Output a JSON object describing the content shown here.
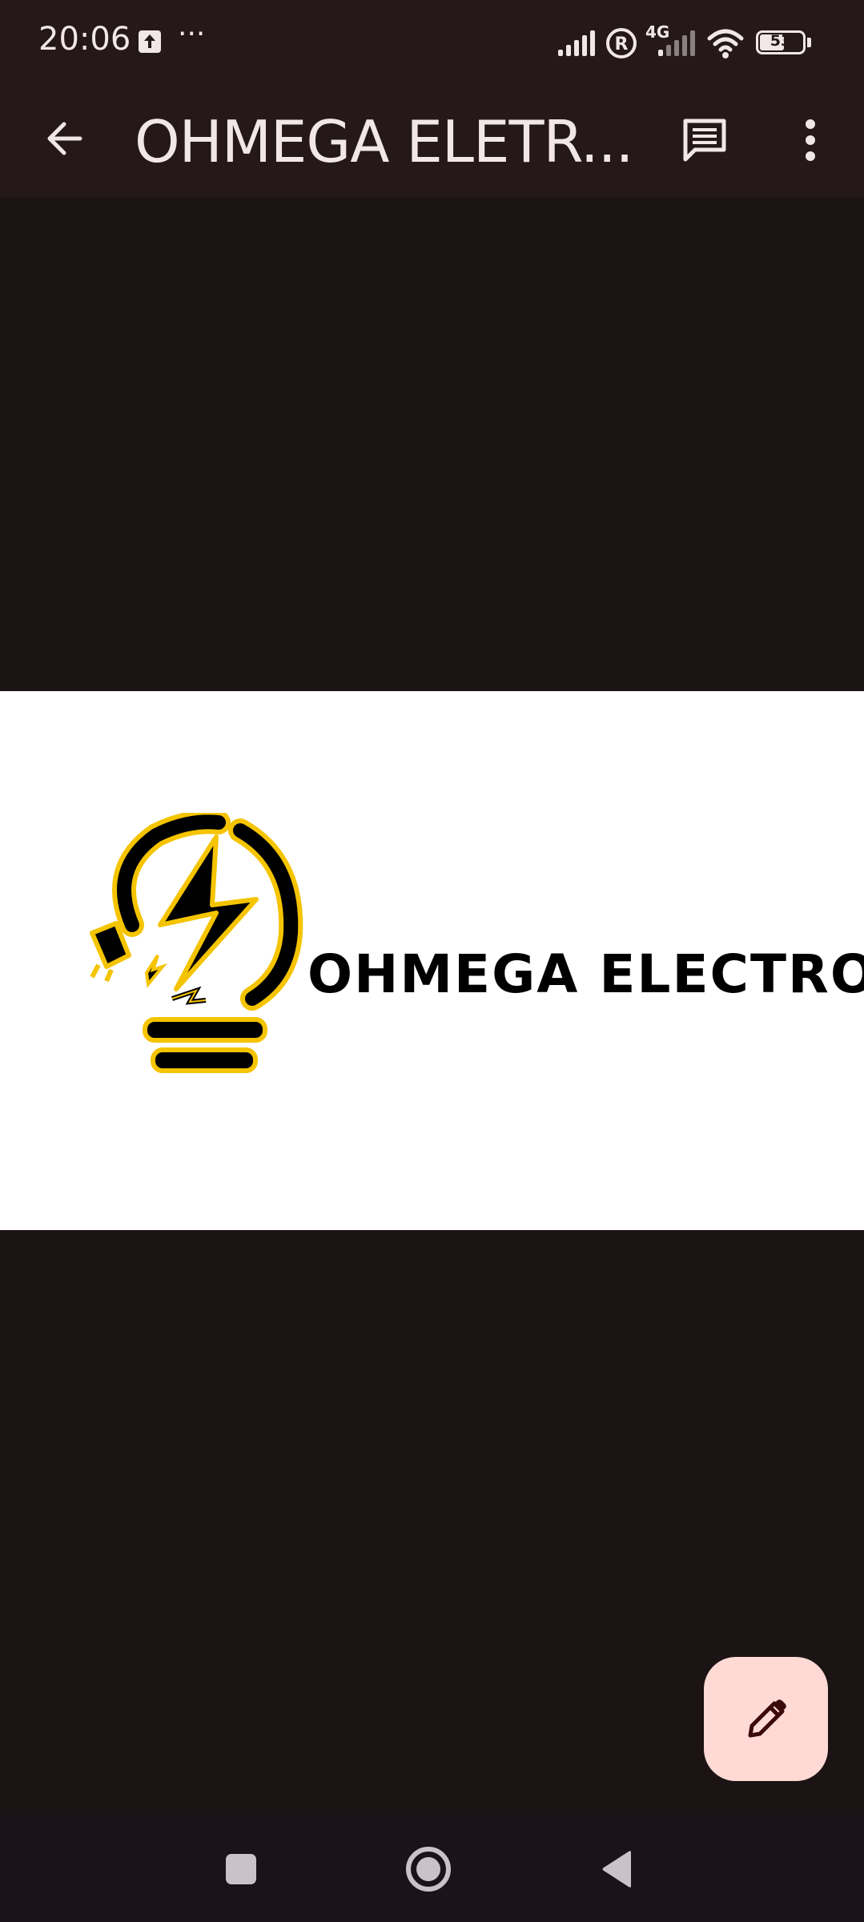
{
  "status_bar": {
    "time": "20:06",
    "indicator": "4G",
    "battery": "53",
    "icons": [
      "upload-icon",
      "more-dots-icon",
      "signal-icon",
      "roaming-icon",
      "signal-4g-icon",
      "wifi-icon",
      "battery-icon"
    ]
  },
  "app_bar": {
    "title": "OHMEGA ELETR...",
    "icons": [
      "arrow-back-icon",
      "comments-icon",
      "more-vert-icon"
    ]
  },
  "logo": {
    "text": "OHMEGA ELECTRO",
    "colors": {
      "accent": "#f5c400",
      "ink": "#000000"
    }
  },
  "fab": {
    "icon": "pencil-icon"
  },
  "nav_bar": {
    "icons": [
      "recents-square-icon",
      "home-circle-icon",
      "back-triangle-icon"
    ]
  },
  "colors": {
    "app_bar_bg": "#241818",
    "content_bg": "#1c1314",
    "fab_bg": "#ffdad5",
    "on_surface": "#f1e7e6"
  }
}
